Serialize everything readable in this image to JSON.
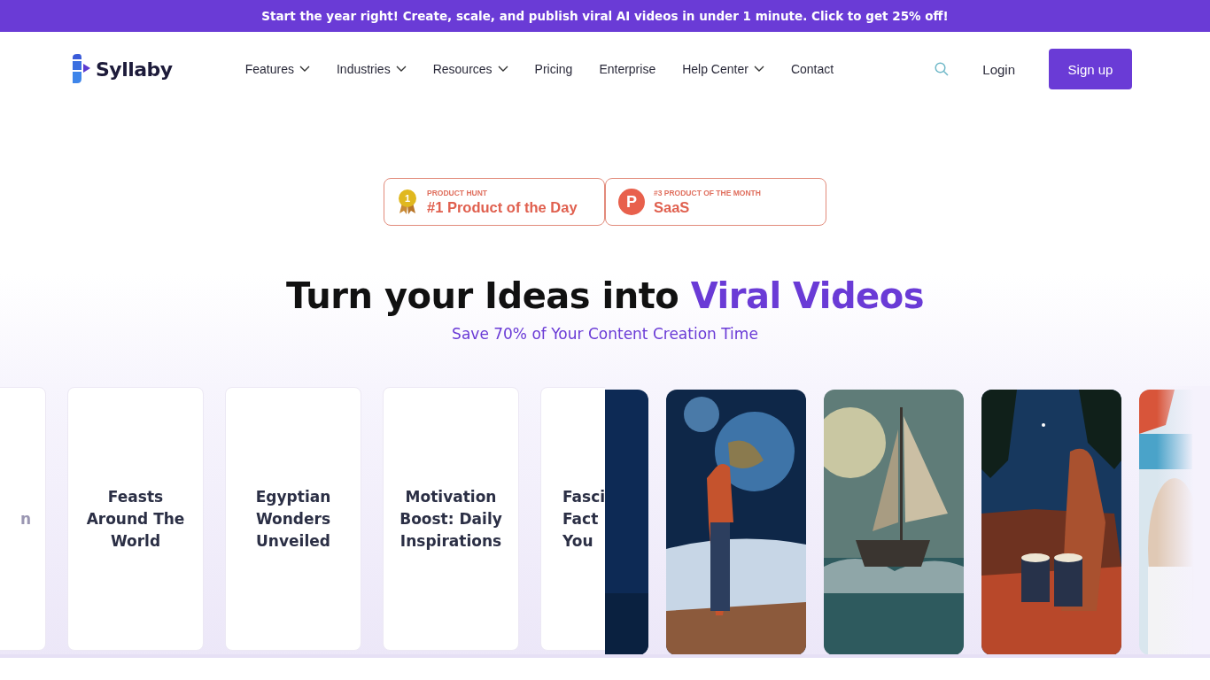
{
  "promo_bar": {
    "text": "Start the year right! Create, scale, and publish viral AI videos in under 1 minute. Click to get 25% off!"
  },
  "header": {
    "logo": "Syllaby",
    "nav": [
      {
        "label": "Features",
        "dropdown": true
      },
      {
        "label": "Industries",
        "dropdown": true
      },
      {
        "label": "Resources",
        "dropdown": true
      },
      {
        "label": "Pricing",
        "dropdown": false
      },
      {
        "label": "Enterprise",
        "dropdown": false
      },
      {
        "label": "Help Center",
        "dropdown": true
      },
      {
        "label": "Contact",
        "dropdown": false
      }
    ],
    "login": "Login",
    "signup": "Sign up"
  },
  "badges": [
    {
      "kind": "medal",
      "icon_text": "1",
      "caption": "PRODUCT HUNT",
      "title": "#1 Product of the Day"
    },
    {
      "kind": "logo",
      "icon_text": "P",
      "caption": "#3 PRODUCT OF THE MONTH",
      "title": "SaaS"
    }
  ],
  "hero": {
    "title": "Turn your Ideas into",
    "title_highlight": "Viral Videos",
    "subtitle": "Save 70% of Your Content Creation Time"
  },
  "topic_cards": [
    {
      "lines": [
        "n"
      ]
    },
    {
      "lines": [
        "Feasts",
        "Around The",
        "World"
      ]
    },
    {
      "lines": [
        "Egyptian",
        "Wonders",
        "Unveiled"
      ]
    },
    {
      "lines": [
        "Motivation",
        "Boost: Daily",
        "Inspirations"
      ]
    },
    {
      "lines": [
        "Fasci",
        "Fact",
        "You"
      ]
    }
  ]
}
